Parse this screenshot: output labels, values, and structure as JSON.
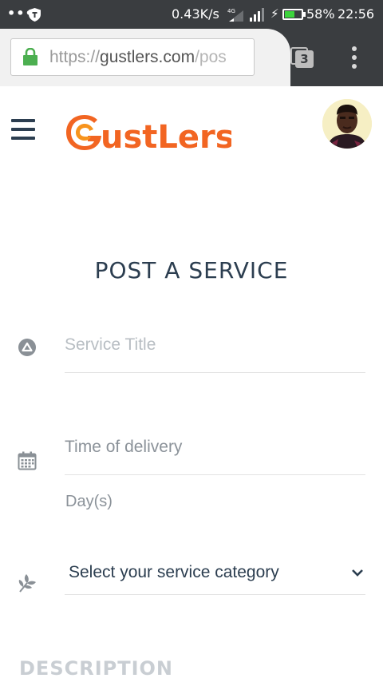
{
  "status_bar": {
    "dots": "•••",
    "network_speed": "0.43K/s",
    "network_type": "4G",
    "battery_percent": "58%",
    "battery_level": 0.58,
    "time": "22:56"
  },
  "browser": {
    "url_scheme": "https://",
    "url_host": "gustlers.com",
    "url_path": "/pos",
    "tab_count": "3",
    "colors": {
      "bar": "#3a3d40",
      "lock": "#4caf50"
    }
  },
  "header": {
    "logo_text": "ustLers",
    "logo_color": "#f26522",
    "menu_icon": "hamburger-icon"
  },
  "form": {
    "title": "POST A SERVICE",
    "service_title_placeholder": "Service Title",
    "time_of_delivery_label": "Time of delivery",
    "days_label": "Day(s)",
    "category_select_value": "Select your service category",
    "description_heading": "DESCRIPTION"
  }
}
